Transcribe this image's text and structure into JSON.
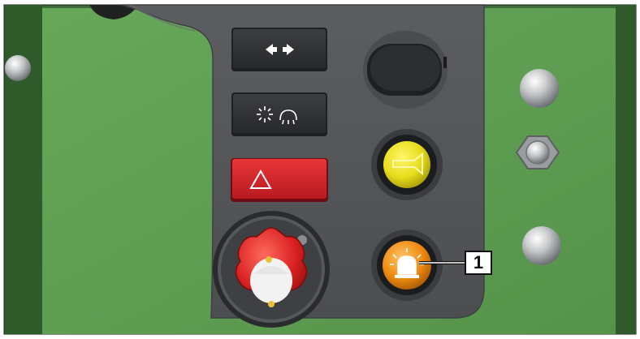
{
  "callout": {
    "label": "1",
    "target": "beacon-switch"
  },
  "panel": {
    "buttons": [
      {
        "name": "direction-indicator-button",
        "icon": "arrows-left-right-icon"
      },
      {
        "name": "work-light-button",
        "icon": "light-and-wiper-icon"
      },
      {
        "name": "hazard-warning-button",
        "icon": "warning-triangle-icon",
        "color": "#d6262c"
      },
      {
        "name": "horn-button",
        "icon": "horn-icon",
        "color": "#e8dc1c"
      },
      {
        "name": "beacon-switch",
        "icon": "rotating-beacon-icon",
        "color": "#ef8b10"
      },
      {
        "name": "battery-isolator-switch",
        "icon": "battery-isolator-knob",
        "color": "#d82020"
      }
    ]
  },
  "colors": {
    "machine_green": "#5d9c51",
    "dark_green": "#2e5a2a",
    "panel_gray": "#555759",
    "button_dark": "#2e3032"
  }
}
